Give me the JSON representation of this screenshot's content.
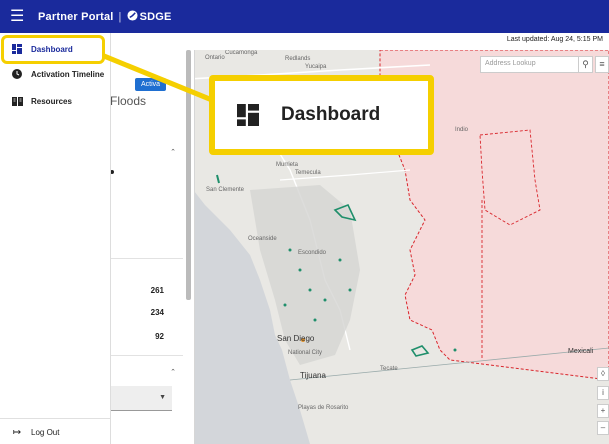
{
  "header": {
    "title": "Partner Portal",
    "logo_text": "SDGE",
    "menu_icon": "hamburger-icon"
  },
  "status": {
    "last_updated": "Last updated: Aug 24, 5:15 PM"
  },
  "sidebar": {
    "items": [
      {
        "label": "Dashboard",
        "icon": "dashboard-icon",
        "active": true
      },
      {
        "label": "Activation Timeline",
        "icon": "clock-icon",
        "active": false
      },
      {
        "label": "Resources",
        "icon": "book-icon",
        "active": false
      }
    ],
    "logout_label": "Log Out"
  },
  "panel": {
    "activate_label": "Activa",
    "title": "Floods",
    "counts": [
      "261",
      "234",
      "92"
    ]
  },
  "search": {
    "placeholder": "Address Lookup"
  },
  "callout": {
    "label": "Dashboard"
  },
  "map": {
    "labels": {
      "cucamonga": "Cucamonga",
      "ontario": "Ontario",
      "redlands": "Redlands",
      "yucaipa": "Yucaipa",
      "indio": "Indio",
      "murrieta": "Murrieta",
      "temecula": "Temecula",
      "san_clemente": "San Clemente",
      "oceanside": "Oceanside",
      "escondido": "Escondido",
      "san_diego": "San Diego",
      "national_city": "National City",
      "tijuana": "Tijuana",
      "tecate": "Tecate",
      "mexicali": "Mexicali",
      "playas": "Playas de Rosarito"
    },
    "colors": {
      "territory_fill": "#f6dada",
      "territory_border": "#d9262c",
      "outage": "#1f8f6b"
    }
  }
}
